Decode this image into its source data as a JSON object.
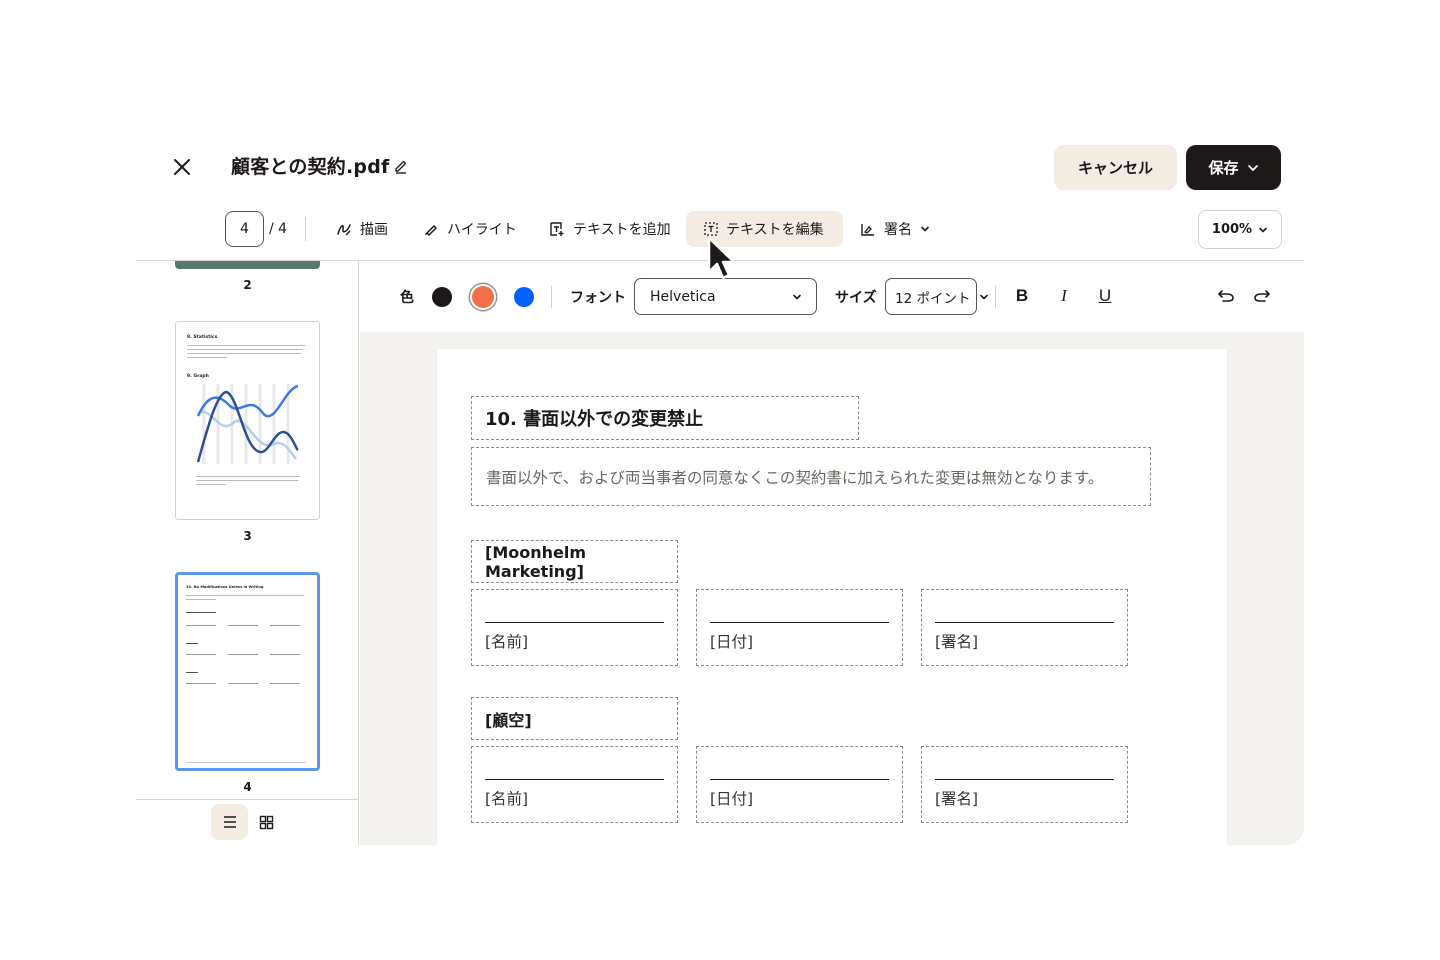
{
  "header": {
    "title": "顧客との契約.pdf",
    "cancel_label": "キャンセル",
    "save_label": "保存"
  },
  "toolbar": {
    "current_page": "4",
    "page_total": "/ 4",
    "tools": [
      {
        "label": "描画",
        "icon": "draw-icon"
      },
      {
        "label": "ハイライト",
        "icon": "highlighter-icon"
      },
      {
        "label": "テキストを追加",
        "icon": "add-text-icon"
      },
      {
        "label": "テキストを編集",
        "icon": "edit-text-icon",
        "active": true
      },
      {
        "label": "署名",
        "icon": "signature-icon"
      }
    ],
    "zoom": "100%"
  },
  "sidebar": {
    "thumbnails": [
      {
        "page": "2"
      },
      {
        "page": "3",
        "heading_a": "8. Statistics",
        "heading_b": "9. Graph"
      },
      {
        "page": "4",
        "heading": "10. No Modifications Unless in Writing",
        "selected": true
      }
    ]
  },
  "format_bar": {
    "color_label": "色",
    "colors": [
      "#1e1919",
      "#f26e4a",
      "#0061fe"
    ],
    "font_label": "フォント",
    "font_value": "Helvetica",
    "size_label": "サイズ",
    "size_value": "12 ポイント",
    "bold": "B",
    "italic": "I",
    "underline": "U"
  },
  "document": {
    "section_title": "10. 書面以外での変更禁止",
    "section_body": "書面以外で、および両当事者の同意なくこの契約書に加えられた変更は無効となります。",
    "party_1": "[Moonhelm Marketing]",
    "party_2": "[顧空]",
    "field_name": "[名前]",
    "field_date": "[日付]",
    "field_signature": "[署名]"
  },
  "colors": {
    "accent_bg": "#f2ece3",
    "dark": "#1e1919",
    "selected_thumb": "#5b95f0"
  }
}
